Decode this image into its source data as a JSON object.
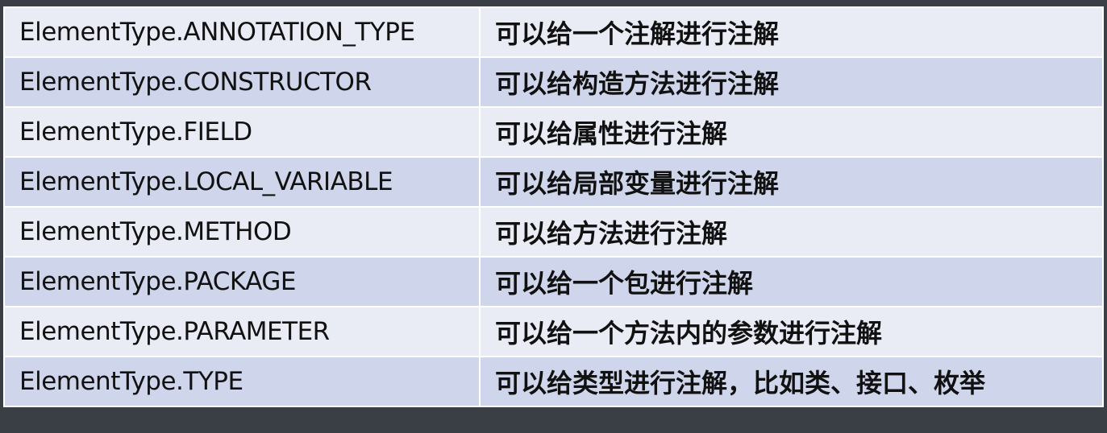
{
  "rows": [
    {
      "type": "ElementType.ANNOTATION_TYPE",
      "desc": "可以给一个注解进行注解"
    },
    {
      "type": "ElementType.CONSTRUCTOR",
      "desc": "可以给构造方法进行注解"
    },
    {
      "type": "ElementType.FIELD",
      "desc": "可以给属性进行注解"
    },
    {
      "type": "ElementType.LOCAL_VARIABLE",
      "desc": "可以给局部变量进行注解"
    },
    {
      "type": "ElementType.METHOD",
      "desc": "可以给方法进行注解"
    },
    {
      "type": "ElementType.PACKAGE",
      "desc": "可以给一个包进行注解"
    },
    {
      "type": "ElementType.PARAMETER",
      "desc": "可以给一个方法内的参数进行注解"
    },
    {
      "type": "ElementType.TYPE",
      "desc": "可以给类型进行注解，比如类、接口、枚举"
    }
  ],
  "colors": {
    "background": "#3a3f46",
    "row_light": "#e9ebf5",
    "row_dark": "#cfd5ea",
    "border": "#ffffff"
  }
}
